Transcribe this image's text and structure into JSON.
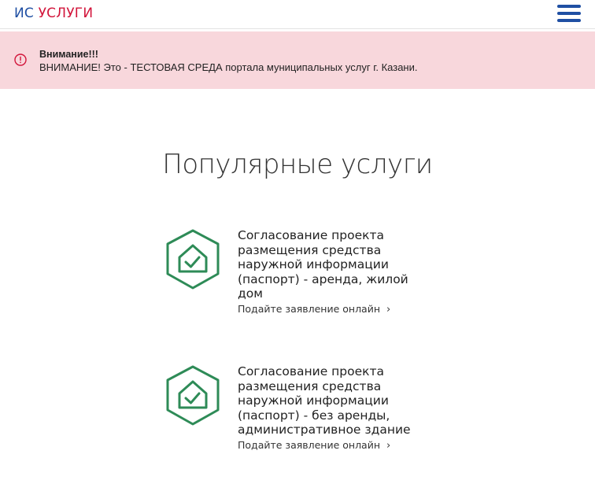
{
  "header": {
    "logo_part1": "ИС",
    "logo_part2": "УСЛУГИ"
  },
  "alert": {
    "title": "Внимание!!!",
    "text": "ВНИМАНИЕ! Это - ТЕСТОВАЯ СРЕДА портала муниципальных услуг г. Казани."
  },
  "popular": {
    "title": "Популярные услуги",
    "services": [
      {
        "name_lines": [
          "Согласование проекта",
          "размещения средства",
          "наружной информации",
          "(паспорт) - аренда, жилой",
          "дом"
        ],
        "apply_label": "Подайте заявление онлайн"
      },
      {
        "name_lines": [
          "Согласование проекта",
          "размещения средства",
          "наружной информации",
          "(паспорт) - без аренды,",
          "административное здание"
        ],
        "apply_label": "Подайте заявление онлайн"
      }
    ]
  },
  "colors": {
    "brand_blue": "#1f4fa3",
    "brand_red": "#d2143a",
    "alert_bg": "#f8d7dc",
    "icon_green": "#2e8b57"
  }
}
